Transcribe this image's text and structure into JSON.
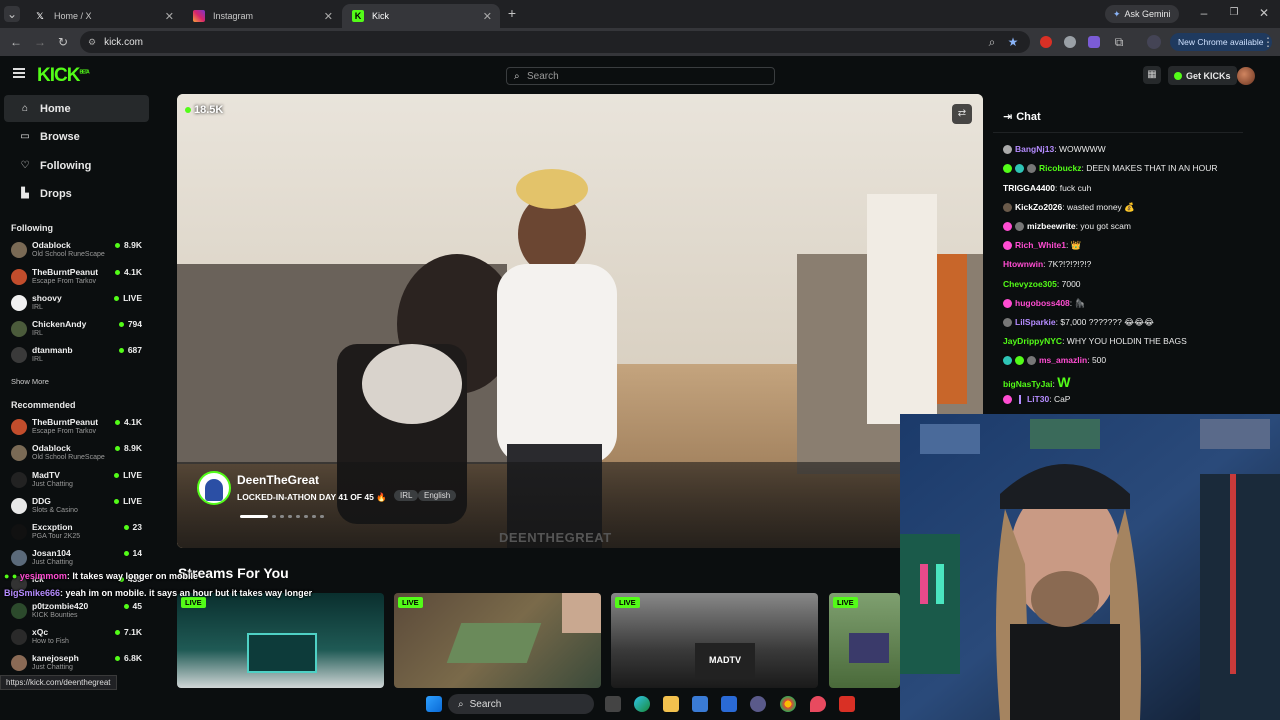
{
  "browser": {
    "tabs": [
      {
        "label": "Home / X",
        "icon": "x-logo-icon"
      },
      {
        "label": "Instagram",
        "icon": "instagram-icon"
      },
      {
        "label": "Kick",
        "icon": "kick-icon"
      }
    ],
    "url": "kick.com",
    "ask_gemini": "Ask Gemini",
    "new_chrome": "New Chrome available"
  },
  "kick": {
    "logo": "KICK",
    "logo_beta": "BETA",
    "search_placeholder": "Search",
    "get_kicks": "Get KICKs"
  },
  "sidebar": {
    "nav": [
      {
        "label": "Home",
        "icon": "home-icon"
      },
      {
        "label": "Browse",
        "icon": "browse-icon"
      },
      {
        "label": "Following",
        "icon": "heart-icon"
      },
      {
        "label": "Drops",
        "icon": "drops-icon"
      }
    ],
    "following_title": "Following",
    "following": [
      {
        "name": "Odablock",
        "category": "Old School RuneScape",
        "viewers": "8.9K"
      },
      {
        "name": "TheBurntPeanut",
        "category": "Escape From Tarkov",
        "viewers": "4.1K"
      },
      {
        "name": "shoovy",
        "category": "IRL",
        "viewers": "LIVE"
      },
      {
        "name": "ChickenAndy",
        "category": "IRL",
        "viewers": "794"
      },
      {
        "name": "dtanmanb",
        "category": "IRL",
        "viewers": "687"
      }
    ],
    "show_more": "Show More",
    "recommended_title": "Recommended",
    "recommended": [
      {
        "name": "TheBurntPeanut",
        "category": "Escape From Tarkov",
        "viewers": "4.1K"
      },
      {
        "name": "Odablock",
        "category": "Old School RuneScape",
        "viewers": "8.9K"
      },
      {
        "name": "MadTV",
        "category": "Just Chatting",
        "viewers": "LIVE"
      },
      {
        "name": "DDG",
        "category": "Slots & Casino",
        "viewers": "LIVE"
      },
      {
        "name": "Excxption",
        "category": "PGA Tour 2K25",
        "viewers": "23"
      },
      {
        "name": "Josan104",
        "category": "Just Chatting",
        "viewers": "14"
      },
      {
        "name": "ick",
        "category": "",
        "viewers": "433"
      },
      {
        "name": "p0tzombie420",
        "category": "KICK Bounties",
        "viewers": "45"
      },
      {
        "name": "xQc",
        "category": "How to Fish",
        "viewers": "7.1K"
      },
      {
        "name": "kanejoseph",
        "category": "Just Chatting",
        "viewers": "6.8K"
      }
    ]
  },
  "player": {
    "viewers": "18.5K",
    "streamer": "DeenTheGreat",
    "title": "LOCKED-IN-ATHON DAY 41 OF 45 🔥",
    "tags": [
      "IRL",
      "English"
    ],
    "watermark": "DEENTHEGREAT"
  },
  "chat": {
    "title": "Chat",
    "messages": [
      {
        "user": "BangNj13",
        "color": "#b58cff",
        "text": "WOWWWW"
      },
      {
        "user": "Ricobuckz",
        "color": "#53fc18",
        "text": "DEEN MAKES THAT IN AN HOUR"
      },
      {
        "user": "TRIGGA4400",
        "color": "#ffffff",
        "text": "fuck cuh"
      },
      {
        "user": "KickZo2026",
        "color": "#ffffff",
        "text": "wasted money 💰"
      },
      {
        "user": "mizbeewrite",
        "color": "#ffffff",
        "text": "you got scam"
      },
      {
        "user": "Rich_White1",
        "color": "#ff4dd2",
        "text": "👑"
      },
      {
        "user": "Htownwin",
        "color": "#ff4dd2",
        "text": "7K?!?!?!?!?"
      },
      {
        "user": "Chevyzoe305",
        "color": "#53fc18",
        "text": "7000"
      },
      {
        "user": "hugoboss408",
        "color": "#ff4dd2",
        "text": "🦍"
      },
      {
        "user": "LilSparkie",
        "color": "#b58cff",
        "text": "$7,000 ??????? 😂😂😂"
      },
      {
        "user": "JayDrippyNYC",
        "color": "#53fc18",
        "text": "WHY YOU HOLDIN THE BAGS"
      },
      {
        "user": "ms_amazlin",
        "color": "#ff4dd2",
        "text": "500"
      },
      {
        "user": "bigNasTyJai",
        "color": "#53fc18",
        "text": "W"
      },
      {
        "user": "LiT30",
        "color": "#b58cff",
        "text": "CaP"
      }
    ]
  },
  "streams": {
    "section_title": "Streams For You",
    "section_highlight": "Streams",
    "live_label": "LIVE"
  },
  "overlay": {
    "line1_user": "yesimmom",
    "line1_text": "It takes way longer on mobile",
    "line2_user": "BigSmike666",
    "line2_text": "yeah im on mobile. it says an hour but it takes way longer"
  },
  "status_url": "https://kick.com/deenthegreat",
  "taskbar": {
    "search": "Search"
  },
  "colors": {
    "kick_green": "#53fc18",
    "bg": "#0b0e0f"
  }
}
